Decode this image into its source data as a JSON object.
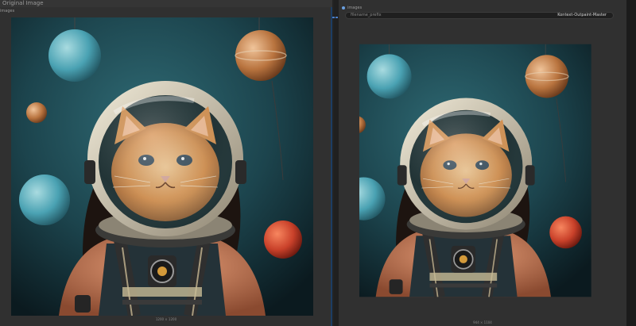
{
  "left_node": {
    "title": "Original Image",
    "output_label": "images",
    "image_caption": "1200 × 1200"
  },
  "right_node": {
    "output_label": "images",
    "widget": {
      "label": "filename_prefix",
      "value": "Kontext-Outpaint-Master"
    },
    "image_caption": "944 × 1104"
  },
  "colors": {
    "node_bg": "#303030",
    "selected_border": "#1c3d63",
    "link": "#4a7ec7"
  }
}
